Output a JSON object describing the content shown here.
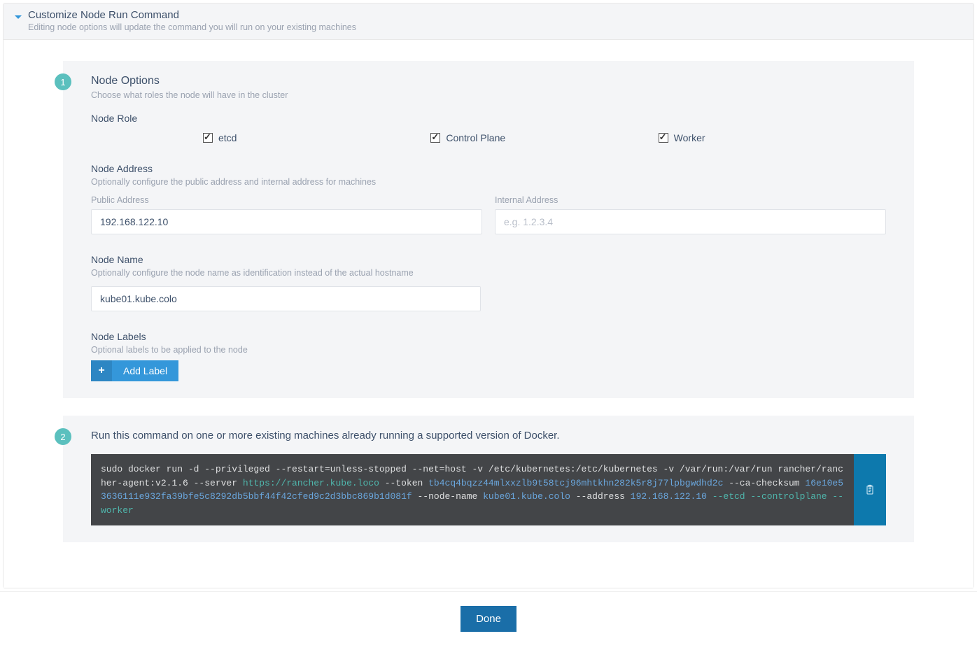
{
  "header": {
    "title": "Customize Node Run Command",
    "subtitle": "Editing node options will update the command you will run on your existing machines"
  },
  "step1": {
    "badge": "1",
    "title": "Node Options",
    "subtitle": "Choose what roles the node will have in the cluster",
    "nodeRole": {
      "heading": "Node Role",
      "etcd": "etcd",
      "controlPlane": "Control Plane",
      "worker": "Worker"
    },
    "nodeAddress": {
      "heading": "Node Address",
      "subtitle": "Optionally configure the public address and internal address for machines",
      "publicLabel": "Public Address",
      "publicValue": "192.168.122.10",
      "internalLabel": "Internal Address",
      "internalPlaceholder": "e.g. 1.2.3.4"
    },
    "nodeName": {
      "heading": "Node Name",
      "subtitle": "Optionally configure the node name as identification instead of the actual hostname",
      "value": "kube01.kube.colo"
    },
    "nodeLabels": {
      "heading": "Node Labels",
      "subtitle": "Optional labels to be applied to the node",
      "addButton": "Add Label"
    }
  },
  "step2": {
    "badge": "2",
    "text": "Run this command on one or more existing machines already running a supported version of Docker.",
    "cmd": {
      "p1": "sudo docker run -d --privileged --restart=unless-stopped --net=host -v /etc/kubernetes:/etc/kubernetes -v /var/run:/var/run rancher/rancher-agent:v2.1.6 --server ",
      "server": "https://rancher.kube.loco",
      "p2": " --token ",
      "token": "tb4cq4bqzz44mlxxzlb9t58tcj96mhtkhn282k5r8j77lpbgwdhd2c",
      "p3": " --ca-checksum ",
      "checksum": "16e10e53636111e932fa39bfe5c8292db5bbf44f42cfed9c2d3bbc869b1d081f",
      "p4": " --node-name ",
      "nodeName": "kube01.kube.colo",
      "p5": " --address ",
      "address": "192.168.122.10",
      "flags": " --etcd --controlplane --worker"
    }
  },
  "footer": {
    "done": "Done"
  }
}
